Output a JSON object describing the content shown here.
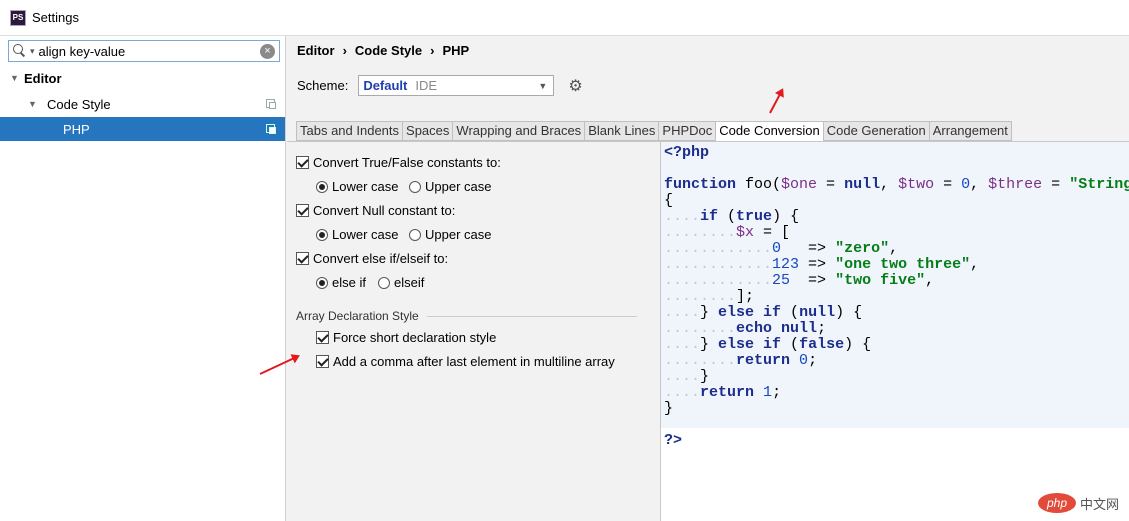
{
  "window": {
    "title": "Settings",
    "logo": "PS"
  },
  "search": {
    "value": "align key-value"
  },
  "tree": {
    "editor": "Editor",
    "code_style": "Code Style",
    "php": "PHP"
  },
  "breadcrumb": [
    "Editor",
    "Code Style",
    "PHP"
  ],
  "scheme": {
    "label": "Scheme:",
    "name": "Default",
    "type": "IDE"
  },
  "tabs": [
    "Tabs and Indents",
    "Spaces",
    "Wrapping and Braces",
    "Blank Lines",
    "PHPDoc",
    "Code Conversion",
    "Code Generation",
    "Arrangement"
  ],
  "active_tab": "Code Conversion",
  "options": {
    "true_false": {
      "label": "Convert True/False constants to:",
      "checked": true,
      "lower": "Lower case",
      "upper": "Upper case",
      "selected": "lower"
    },
    "null": {
      "label": "Convert Null constant to:",
      "checked": true,
      "lower": "Lower case",
      "upper": "Upper case",
      "selected": "lower"
    },
    "else_if": {
      "label": "Convert else if/elseif to:",
      "checked": true,
      "a": "else if",
      "b": "elseif",
      "selected": "a"
    },
    "array_group": "Array Declaration Style",
    "short_decl": {
      "label": "Force short declaration style",
      "checked": true
    },
    "comma": {
      "label": "Add a comma after last element in multiline array",
      "checked": true
    }
  },
  "watermark": {
    "logo": "php",
    "text": "中文网"
  },
  "colors": {
    "selection": "#2675bf",
    "annotation_arrow": "#e3191c",
    "keyword": "#1c2d8c",
    "string": "#067d17",
    "number": "#1848c0",
    "variable": "#7b2f86"
  }
}
